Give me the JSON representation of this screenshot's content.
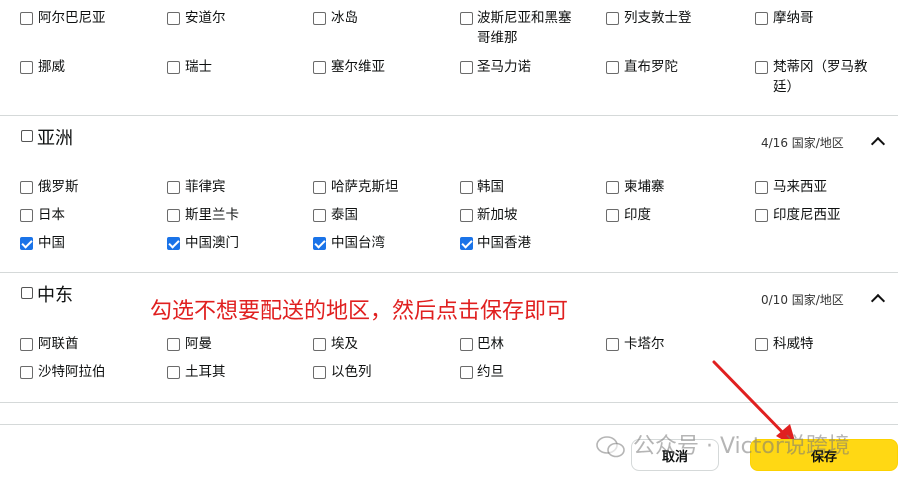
{
  "europe_rows": [
    [
      "阿尔巴尼亚",
      "安道尔",
      "冰岛",
      "波斯尼亚和黑塞哥维那",
      "列支敦士登",
      "摩纳哥"
    ],
    [
      "挪威",
      "瑞士",
      "塞尔维亚",
      "圣马力诺",
      "直布罗陀",
      "梵蒂冈（罗马教廷）"
    ]
  ],
  "asia": {
    "title": "亚洲",
    "count": "4/16 国家/地区",
    "rows": [
      [
        {
          "label": "俄罗斯",
          "checked": false
        },
        {
          "label": "菲律宾",
          "checked": false
        },
        {
          "label": "哈萨克斯坦",
          "checked": false
        },
        {
          "label": "韩国",
          "checked": false
        },
        {
          "label": "柬埔寨",
          "checked": false
        },
        {
          "label": "马来西亚",
          "checked": false
        }
      ],
      [
        {
          "label": "日本",
          "checked": false
        },
        {
          "label": "斯里兰卡",
          "checked": false
        },
        {
          "label": "泰国",
          "checked": false
        },
        {
          "label": "新加坡",
          "checked": false
        },
        {
          "label": "印度",
          "checked": false
        },
        {
          "label": "印度尼西亚",
          "checked": false
        }
      ],
      [
        {
          "label": "中国",
          "checked": true
        },
        {
          "label": "中国澳门",
          "checked": true
        },
        {
          "label": "中国台湾",
          "checked": true
        },
        {
          "label": "中国香港",
          "checked": true
        }
      ]
    ]
  },
  "middle_east": {
    "title": "中东",
    "count": "0/10 国家/地区",
    "rows": [
      [
        "阿联酋",
        "阿曼",
        "埃及",
        "巴林",
        "卡塔尔",
        "科威特"
      ],
      [
        "沙特阿拉伯",
        "土耳其",
        "以色列",
        "约旦"
      ]
    ]
  },
  "annotation": "勾选不想要配送的地区，然后点击保存即可",
  "buttons": {
    "cancel": "取消",
    "save": "保存"
  },
  "watermark": "公众号 · Victor说跨境",
  "colors": {
    "checkbox_checked": "#1a73e8",
    "save_button": "#ffd814",
    "annotation": "#e02020"
  }
}
